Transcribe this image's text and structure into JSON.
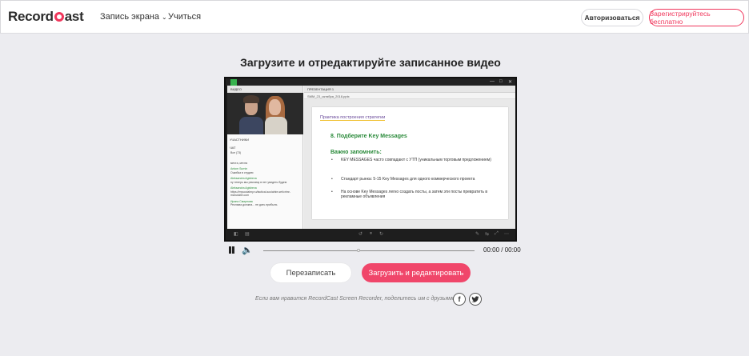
{
  "header": {
    "logo_left": "Record",
    "logo_right": "ast",
    "nav": [
      {
        "label": "Запись экрана"
      },
      {
        "label": "Учиться"
      }
    ],
    "login_label": "Авторизоваться",
    "signup_label": "Зарегистрируйтесь бесплатно"
  },
  "main": {
    "title": "Загрузите и отредактируйте записанное видео",
    "video": {
      "left_panel_title": "ВИДЕО",
      "participants_label": "УЧАСТНИКИ",
      "chat_label": "ЧАТ",
      "chat": [
        {
          "name": "",
          "text": "Все (73)"
        },
        {
          "name": "",
          "text": "мечта, мечта"
        },
        {
          "name": "Antom Surnin",
          "text": "Ошибка в студию"
        },
        {
          "name": "Aleksandra Agisheva",
          "text": "ну теперь мы рекламу в нет увидеть будем"
        },
        {
          "name": "Aleksandra Agisheva",
          "text": "https://mysocialmy.ru/tactical-socialnie-set/crimr-manutube.com"
        },
        {
          "name": "Ирина Смирнова",
          "text": "Реклама должна... не дать прибыль"
        }
      ],
      "right_panel_title": "ПРЕЗЕНТАЦИЯ 1",
      "file_tab": "SMM_23_октября_2018.pptx",
      "slide": {
        "crumb": "Практика построения стратегии",
        "heading": "8. Подберите  Key Messages",
        "subheading": "Важно запомнить:",
        "bullets": [
          "KEY MESSAGES часто совпадают с УТП (уникальным торговым предложением)",
          "Стандарт рынка: 5-15 Key Messages для одного коммерческого проекта",
          "На основе Key Messages легко создать посты, а затем эти посты превратить в рекламные объявления"
        ]
      }
    },
    "player": {
      "time": "00:00 / 00:00",
      "progress": 0.45
    },
    "rerecord_label": "Перезаписать",
    "upload_label": "Загрузить и редактировать",
    "share_text": "Если вам нравится RecordCast Screen Recorder, поделитесь им с друзьями."
  },
  "colors": {
    "accent": "#f0365b",
    "background": "#ececf0"
  },
  "icons": [
    "chevron-down-icon",
    "pause-icon",
    "volume-icon",
    "facebook-icon",
    "twitter-icon"
  ]
}
